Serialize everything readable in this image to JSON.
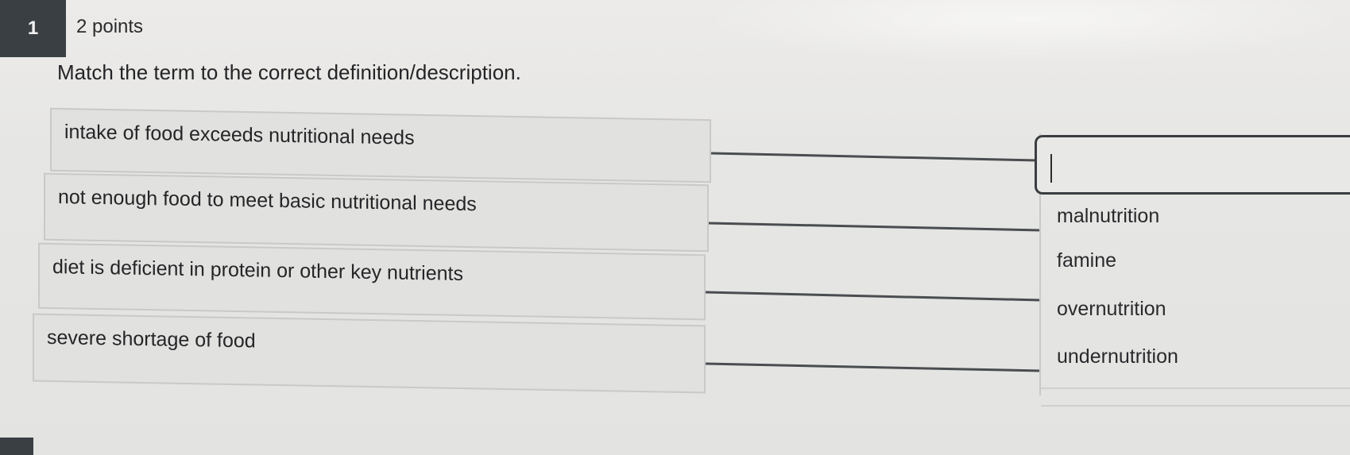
{
  "question": {
    "number": "1",
    "points": "2 points",
    "prompt": "Match the term to the correct definition/description."
  },
  "terms": [
    "intake of food exceeds nutritional needs",
    "not enough food to meet basic nutritional needs",
    "diet is deficient in protein or other key nutrients",
    "severe shortage of food"
  ],
  "answer_slot": {
    "value": ""
  },
  "options": [
    "malnutrition",
    "famine",
    "overnutrition",
    "undernutrition"
  ],
  "colors": {
    "question_number_bg": "#3a3f44",
    "box_bg": "#e1e1df",
    "connector_line": "#4a4d50",
    "background": "#e6e6e4"
  }
}
